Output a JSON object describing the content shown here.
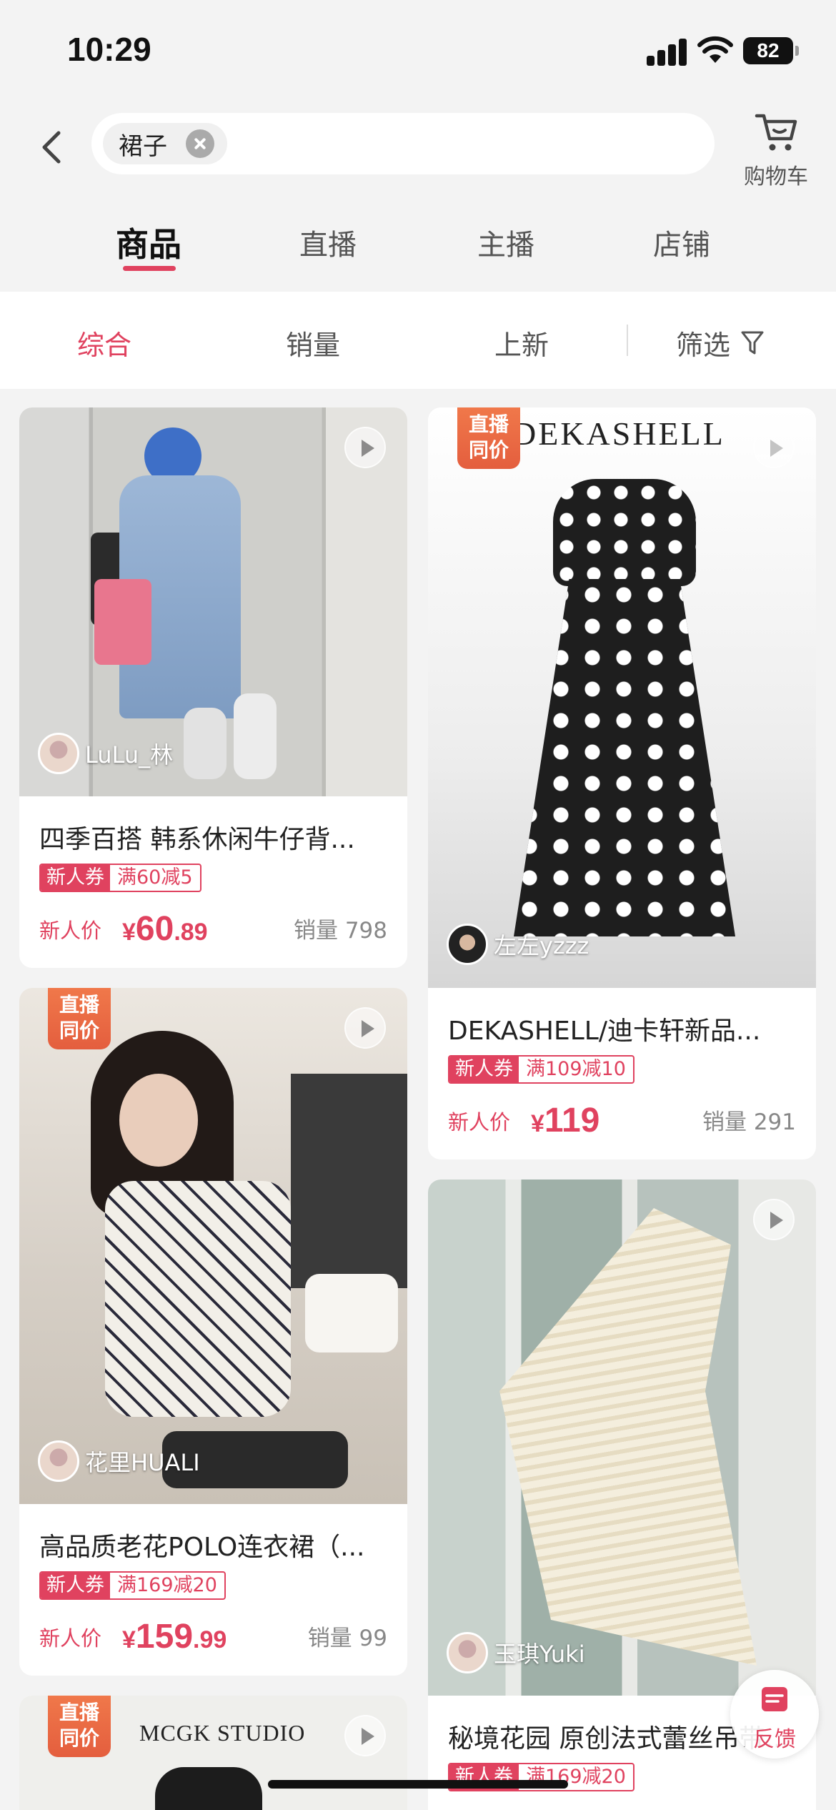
{
  "status_bar": {
    "time": "10:29",
    "battery": "82"
  },
  "search": {
    "query": "裙子"
  },
  "header": {
    "cart_label": "购物车"
  },
  "tabs": [
    {
      "label": "商品",
      "active": true
    },
    {
      "label": "直播"
    },
    {
      "label": "主播"
    },
    {
      "label": "店铺"
    }
  ],
  "sort": {
    "items": [
      "综合",
      "销量",
      "上新"
    ],
    "filter_label": "筛选"
  },
  "colors": {
    "accent": "#e0425f",
    "badge": "#e45e3e"
  },
  "products": [
    {
      "title": "四季百搭 韩系休闲牛仔背...",
      "author": "LuLu_林",
      "coupon_tag": "新人券",
      "coupon_value": "满60减5",
      "price_prefix": "新人价",
      "yen": "¥",
      "price_int": "60",
      "price_dec": ".89",
      "sales": "销量 798",
      "has_live_badge": false
    },
    {
      "title": "DEKASHELL/迪卡轩新品...",
      "author": "左左yzzz",
      "brand_text": "DEKASHELL",
      "badge": [
        "直播",
        "同价"
      ],
      "coupon_tag": "新人券",
      "coupon_value": "满109减10",
      "price_prefix": "新人价",
      "yen": "¥",
      "price_int": "119",
      "price_dec": "",
      "sales": "销量 291"
    },
    {
      "title": "高品质老花POLO连衣裙（...",
      "author": "花里HUALI",
      "badge": [
        "直播",
        "同价"
      ],
      "coupon_tag": "新人券",
      "coupon_value": "满169减20",
      "price_prefix": "新人价",
      "yen": "¥",
      "price_int": "159",
      "price_dec": ".99",
      "sales": "销量 99"
    },
    {
      "title": "秘境花园 原创法式蕾丝吊带...",
      "author": "玉琪Yuki",
      "coupon_tag": "新人券",
      "coupon_value": "满169减20"
    },
    {
      "brand_text": "MCGK STUDIO",
      "badge": [
        "直播",
        "同价"
      ]
    }
  ],
  "feedback_label": "反馈"
}
